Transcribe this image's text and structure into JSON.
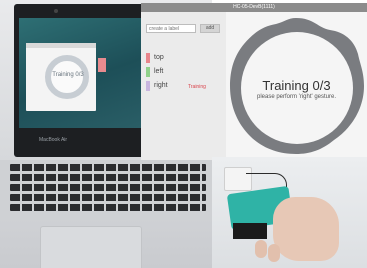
{
  "app": {
    "window_title": "HC-05-DevB(1111)",
    "label_input": {
      "placeholder": "create a label"
    },
    "add_button_label": "add",
    "gestures": [
      {
        "label": "top",
        "color": "#e8868c",
        "status": ""
      },
      {
        "label": "left",
        "color": "#8fd18a",
        "status": ""
      },
      {
        "label": "right",
        "color": "#c9b6df",
        "status": "Training"
      }
    ],
    "main": {
      "title": "Training 0/3",
      "subtitle": "please perform 'right' gesture."
    }
  },
  "laptop": {
    "mini_screen_text": "Training 0/3",
    "brand": "MacBook Air"
  },
  "colors": {
    "blob_fill": "#7a7c80",
    "status_text": "#d9434b",
    "wristband": "#2fb3a6"
  }
}
